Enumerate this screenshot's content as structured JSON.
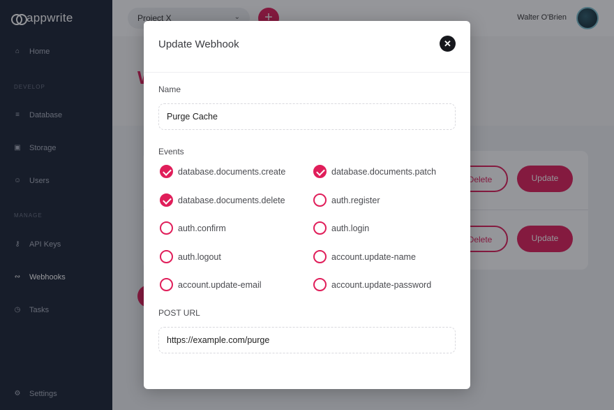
{
  "app": {
    "logo_text": "appwrite"
  },
  "sidebar": {
    "items": [
      {
        "label": "Home",
        "icon": "home-icon"
      },
      {
        "label": "Database",
        "icon": "database-icon"
      },
      {
        "label": "Storage",
        "icon": "storage-icon"
      },
      {
        "label": "Users",
        "icon": "users-icon"
      },
      {
        "label": "API Keys",
        "icon": "key-icon"
      },
      {
        "label": "Webhooks",
        "icon": "webhook-icon"
      },
      {
        "label": "Tasks",
        "icon": "clock-icon"
      },
      {
        "label": "Settings",
        "icon": "gear-icon"
      }
    ],
    "sections": [
      "DEVELOP",
      "MANAGE"
    ],
    "active": "Webhooks"
  },
  "topbar": {
    "project": "Project X",
    "user_name": "Walter O'Brien"
  },
  "background": {
    "title_letter": "W",
    "delete_label": "Delete",
    "update_label": "Update"
  },
  "modal": {
    "title": "Update Webhook",
    "close_symbol": "✕",
    "name_label": "Name",
    "name_value": "Purge Cache",
    "events_label": "Events",
    "events": [
      {
        "name": "database.documents.create",
        "checked": true
      },
      {
        "name": "database.documents.patch",
        "checked": true
      },
      {
        "name": "database.documents.delete",
        "checked": true
      },
      {
        "name": "auth.register",
        "checked": false
      },
      {
        "name": "auth.confirm",
        "checked": false
      },
      {
        "name": "auth.login",
        "checked": false
      },
      {
        "name": "auth.logout",
        "checked": false
      },
      {
        "name": "account.update-name",
        "checked": false
      },
      {
        "name": "account.update-email",
        "checked": false
      },
      {
        "name": "account.update-password",
        "checked": false
      }
    ],
    "url_label": "POST URL",
    "url_value": "https://example.com/purge"
  },
  "colors": {
    "accent": "#e01e5a",
    "sidebar_bg": "#1b2434"
  }
}
